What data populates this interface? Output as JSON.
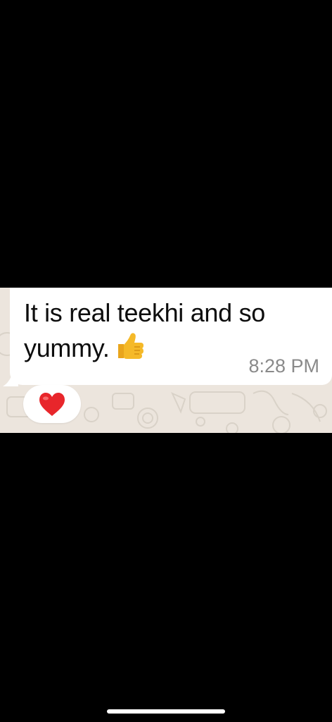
{
  "message": {
    "text": "It is real teekhi and so yummy.",
    "emoji_icon": "thumbs-up-icon",
    "timestamp": "8:28 PM"
  },
  "reaction": {
    "icon": "red-heart-icon"
  },
  "colors": {
    "background": "#000000",
    "chat_wallpaper": "#ece5dd",
    "bubble": "#ffffff",
    "message_text": "#0d0d0d",
    "timestamp_text": "#8a8a8a",
    "heart": "#e8262b",
    "thumb": "#f5b928"
  }
}
